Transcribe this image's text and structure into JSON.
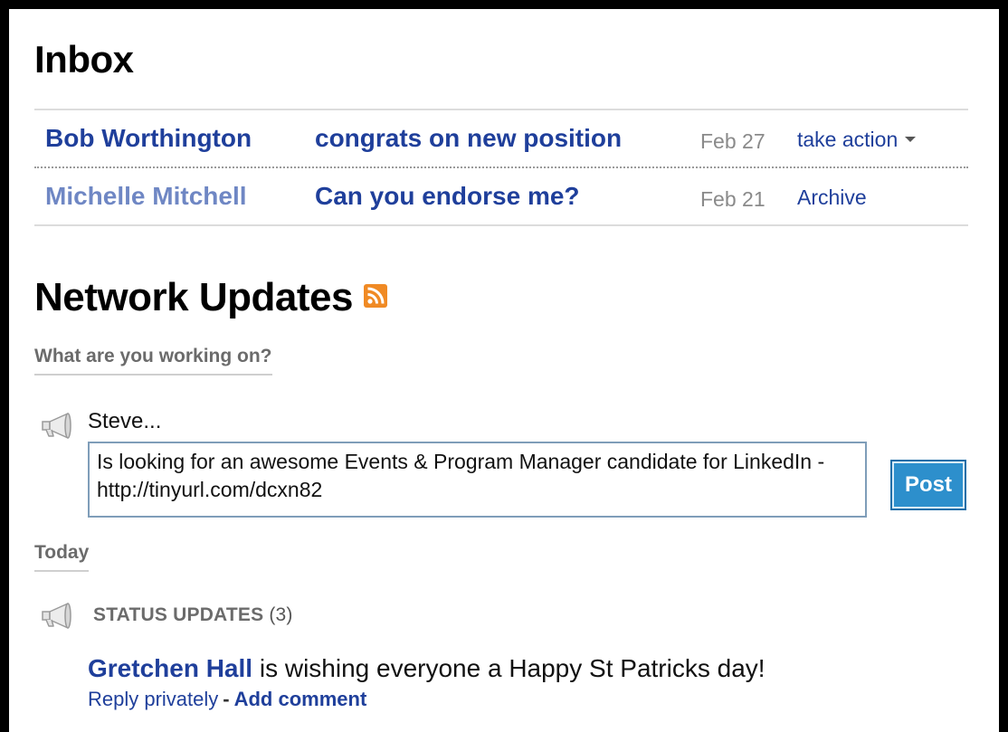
{
  "inbox": {
    "title": "Inbox",
    "messages": [
      {
        "sender": "Bob Worthington",
        "subject": "congrats on new position",
        "date": "Feb 27",
        "action": "take action"
      },
      {
        "sender": "Michelle Mitchell",
        "subject": "Can you endorse me?",
        "date": "Feb 21",
        "action": "Archive"
      }
    ]
  },
  "network_updates": {
    "title": "Network Updates",
    "rss_icon": "rss-feed-icon",
    "prompt": "What are you working on?",
    "user_name": "Steve...",
    "status_text": "Is looking for an awesome Events & Program Manager candidate for LinkedIn - http://tinyurl.com/dcxn82",
    "post_label": "Post",
    "today_label": "Today",
    "status_updates_label": "STATUS UPDATES",
    "status_updates_count": "(3)",
    "update": {
      "author": "Gretchen Hall",
      "text": " is wishing everyone a Happy St Patricks day!",
      "reply_label": "Reply privately",
      "separator": "-",
      "comment_label": "Add comment"
    }
  },
  "colors": {
    "link": "#1f3f9b",
    "read_sender": "#6f87c4",
    "muted": "#6b6b6b",
    "rss": "#f08a24",
    "post_button": "#2d8fcc"
  }
}
